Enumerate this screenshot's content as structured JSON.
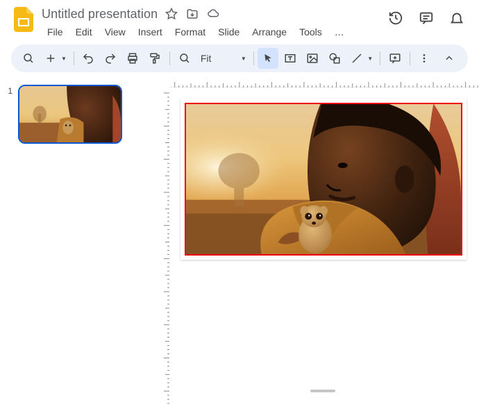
{
  "doc": {
    "title": "Untitled presentation"
  },
  "menubar": [
    "File",
    "Edit",
    "View",
    "Insert",
    "Format",
    "Slide",
    "Arrange",
    "Tools"
  ],
  "toolbar": {
    "zoom_label": "Fit"
  },
  "filmstrip": {
    "slides": [
      {
        "number": "1"
      }
    ]
  },
  "canvas": {
    "image_alt": "Child in profile holding a small meerkat at golden hour, African savanna with baobab tree in background",
    "selection_border_color": "#ee0000"
  }
}
